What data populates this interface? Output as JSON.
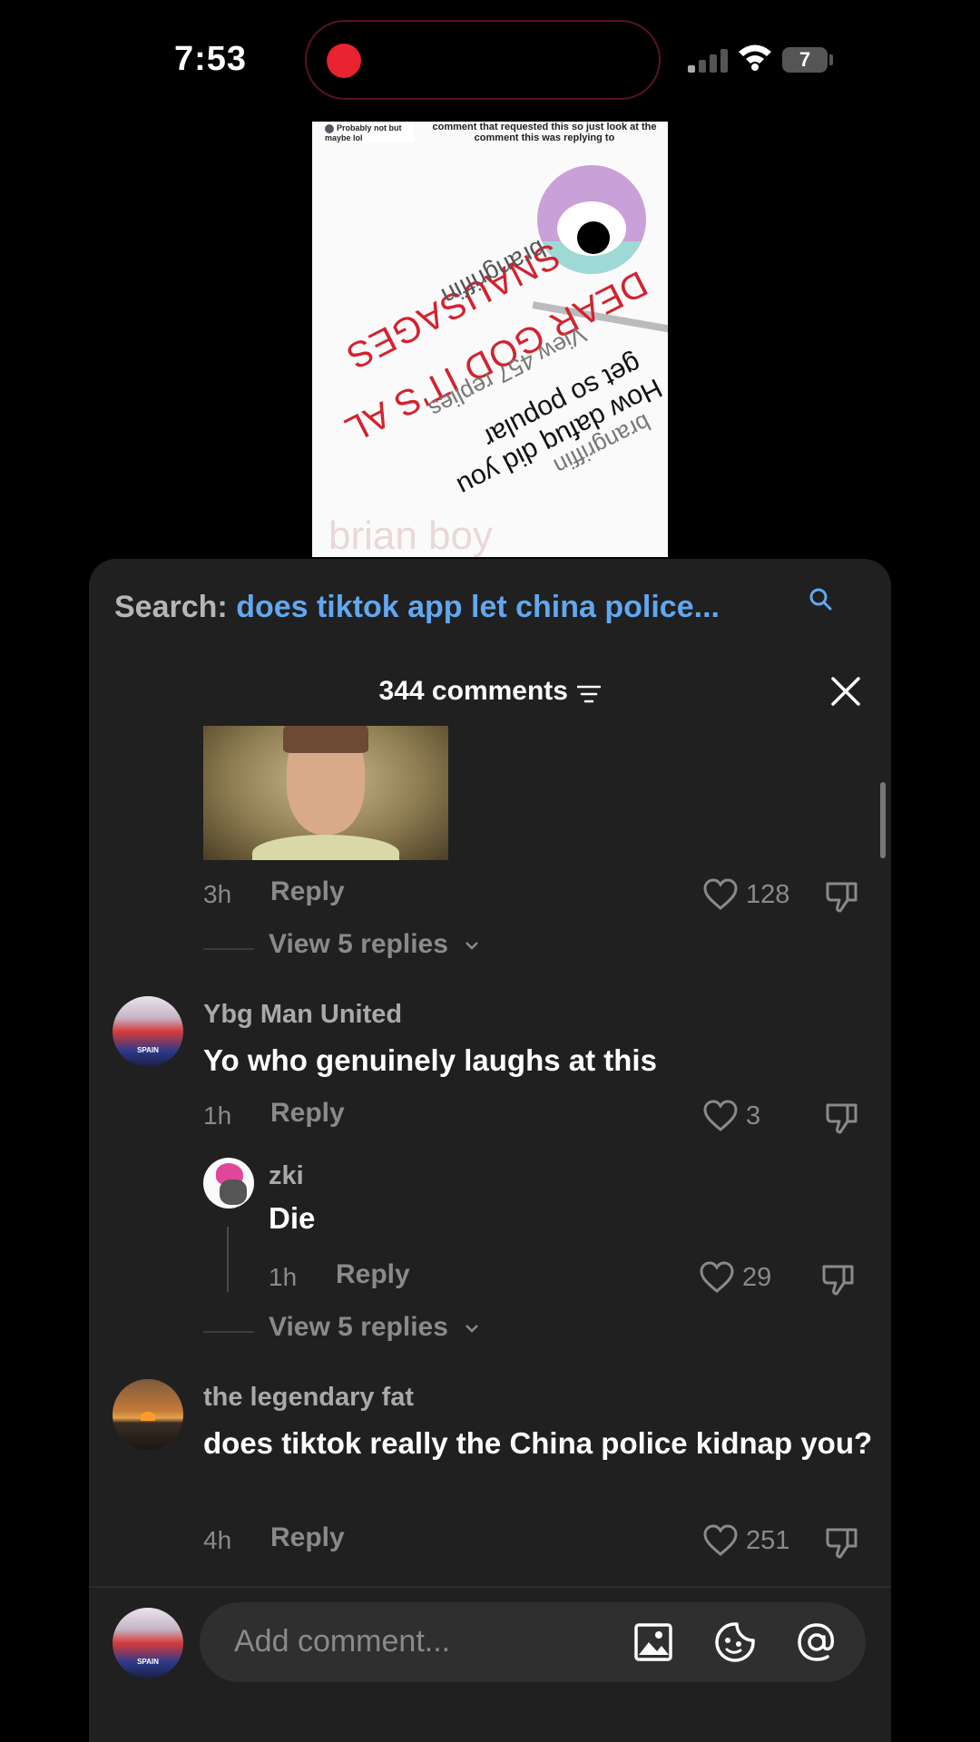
{
  "status_bar": {
    "time": "7:53",
    "battery": "7"
  },
  "video": {
    "top_left_note": "Probably not but maybe lol",
    "top_right_note": "comment that requested this so just look at the comment this was replying to",
    "line_sausages": "SNAUSAGES",
    "line_dear": "DEAR GOD IT'S AL",
    "line_user1": "brangriffin",
    "line_view": "View 457 replies",
    "line_how": "How dafuq did you",
    "line_get": "get so popular",
    "line_user2": "brangriffin",
    "watermark": "brian boy"
  },
  "search": {
    "label": "Search:",
    "query": "does tiktok app let china police..."
  },
  "header": {
    "comment_count": "344 comments"
  },
  "comments": [
    {
      "age": "3h",
      "reply_label": "Reply",
      "likes": "128",
      "view_replies": "View 5 replies"
    },
    {
      "username": "Ybg Man United",
      "text": "Yo who genuinely laughs at this",
      "age": "1h",
      "reply_label": "Reply",
      "likes": "3",
      "avatar_label": "SPAIN",
      "reply": {
        "username": "zki",
        "text": "Die",
        "age": "1h",
        "reply_label": "Reply",
        "likes": "29"
      },
      "view_replies": "View 5 replies"
    },
    {
      "username": "the legendary fat",
      "text": "does tiktok really the China police kidnap you?",
      "age": "4h",
      "reply_label": "Reply",
      "likes": "251"
    }
  ],
  "composer": {
    "placeholder": "Add comment...",
    "avatar_label": "SPAIN"
  },
  "colors": {
    "sheet_bg": "#202020",
    "search_query": "#62a7f0",
    "recording_dot": "#e8222e"
  },
  "icons": [
    "search-icon",
    "filter-icon",
    "close-icon",
    "heart-icon",
    "dislike-icon",
    "chevron-down-icon",
    "image-icon",
    "emoji-icon",
    "mention-icon"
  ]
}
